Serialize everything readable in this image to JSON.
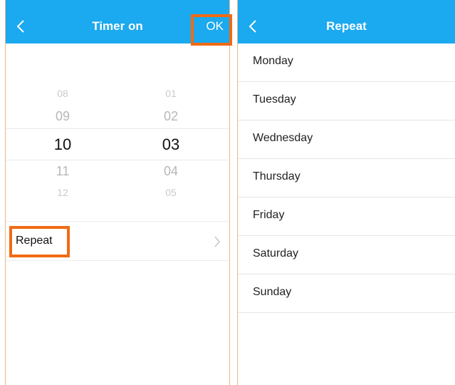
{
  "colors": {
    "navbar": "#1ba9ef",
    "highlight": "#f26a12",
    "text": "#222222",
    "picker_dim": "#b7b7b7"
  },
  "timer_screen": {
    "title": "Timer on",
    "back_icon": "chevron-left-icon",
    "ok_label": "OK",
    "picker": {
      "hours": [
        "08",
        "09",
        "10",
        "11",
        "12"
      ],
      "minutes": [
        "01",
        "02",
        "03",
        "04",
        "05"
      ],
      "selected_hour": "10",
      "selected_minute": "03"
    },
    "repeat_label": "Repeat",
    "repeat_icon": "chevron-right-icon"
  },
  "repeat_screen": {
    "title": "Repeat",
    "back_icon": "chevron-left-icon",
    "days": [
      "Monday",
      "Tuesday",
      "Wednesday",
      "Thursday",
      "Friday",
      "Saturday",
      "Sunday"
    ]
  }
}
